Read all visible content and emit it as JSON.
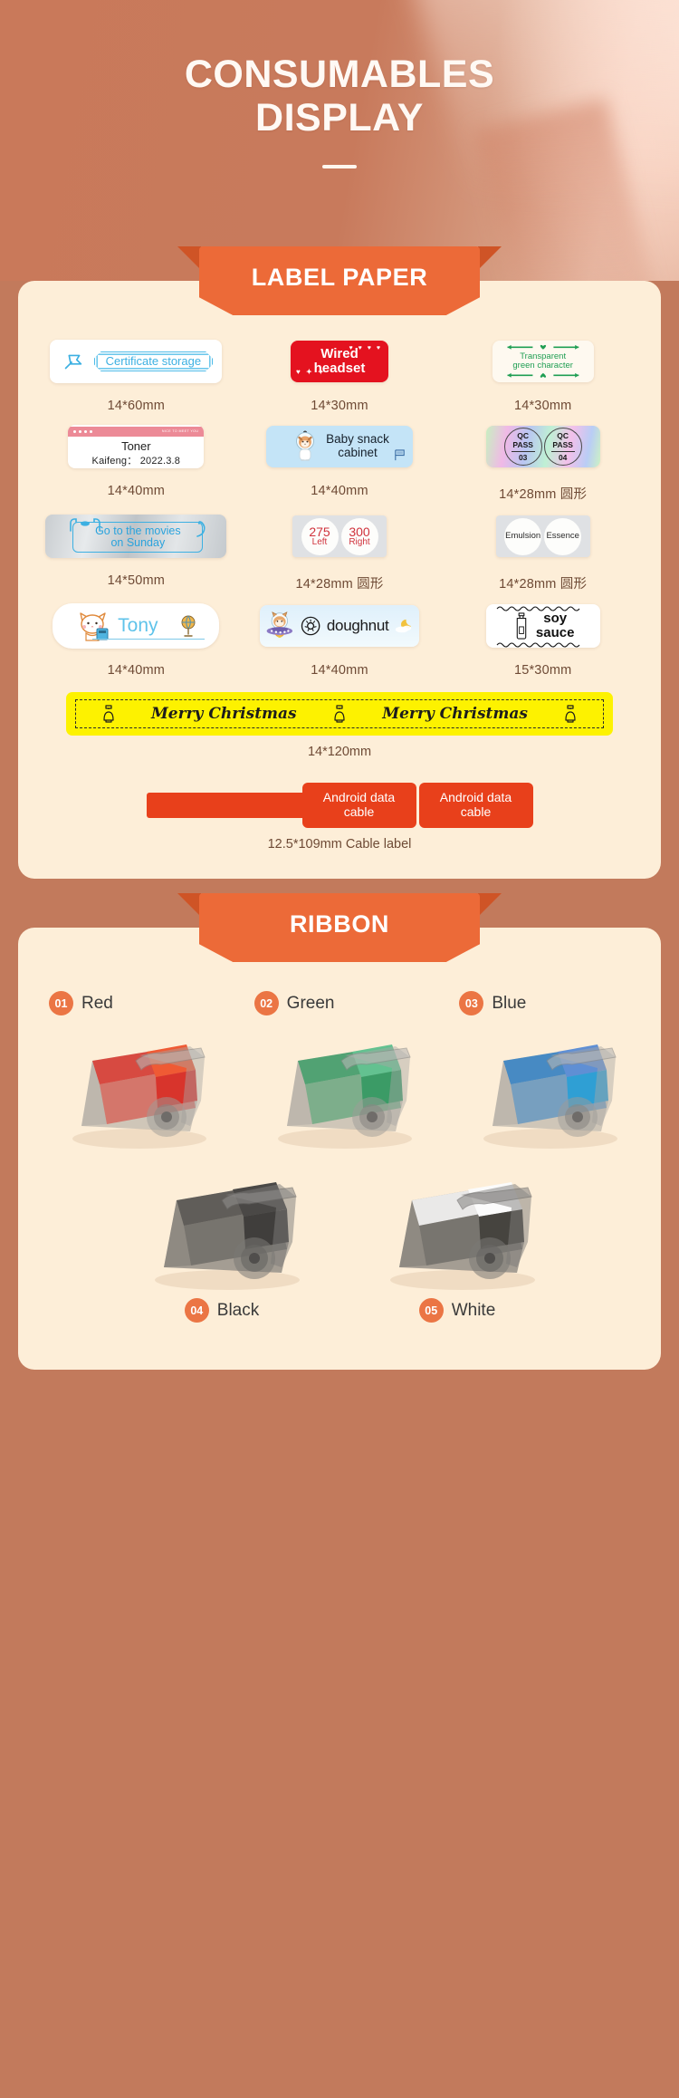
{
  "hero": {
    "title_line1": "CONSUMABLES",
    "title_line2": "DISPLAY",
    "bg_color": "#c87a5c",
    "title_color": "#fff9f4"
  },
  "sections": [
    {
      "banner_label": "LABEL PAPER",
      "banner_color": "#ec6a38"
    },
    {
      "banner_label": "RIBBON",
      "banner_color": "#ec6a38"
    }
  ],
  "label_paper": {
    "row1": [
      {
        "size": "14*60mm",
        "text": "Certificate storage",
        "icon": "pin-icon",
        "color": "#3cb0e2"
      },
      {
        "size": "14*30mm",
        "text_line1": "Wired",
        "text_line2": "headset",
        "color": "#e4121f"
      },
      {
        "size": "14*30mm",
        "text_line1": "Transparent",
        "text_line2": "green character",
        "color": "#1f9e53"
      }
    ],
    "row2": [
      {
        "size": "14*40mm",
        "title": "Toner",
        "subtitle": "Kaifeng： 2022.3.8",
        "header_tag": "NICE TO MEET YOU",
        "color": "#ec8a97"
      },
      {
        "size": "14*40mm",
        "text_line1": "Baby snack",
        "text_line2": "cabinet",
        "icon": "astronaut-dog-icon",
        "color": "#c4e4f7"
      },
      {
        "size": "14*28mm 圆形",
        "circles": [
          {
            "l1": "QC",
            "l2": "PASS",
            "num": "03"
          },
          {
            "l1": "QC",
            "l2": "PASS",
            "num": "04"
          }
        ]
      }
    ],
    "row3": [
      {
        "size": "14*50mm",
        "text_line1": "Go to the movies",
        "text_line2": "on Sunday",
        "color": "#2aa3dd"
      },
      {
        "size": "14*28mm 圆形",
        "circles": [
          {
            "big": "275",
            "sml": "Left"
          },
          {
            "big": "300",
            "sml": "Right"
          }
        ]
      },
      {
        "size": "14*28mm 圆形",
        "circles": [
          {
            "word": "Emulsion"
          },
          {
            "word": "Essence"
          }
        ]
      }
    ],
    "row4": [
      {
        "size": "14*40mm",
        "name": "Tony",
        "icon": "cat-icon"
      },
      {
        "size": "14*40mm",
        "word": "doughnut",
        "icon": "astronaut-cat-icon"
      },
      {
        "size": "15*30mm",
        "text_line1": "soy",
        "text_line2": "sauce",
        "icon": "bottle-icon"
      }
    ],
    "christmas": {
      "size": "14*120mm",
      "text": "Merry Christmas",
      "repeats": 2,
      "bg_color": "#fdf200",
      "bell_icon": "bell-icon"
    },
    "cable": {
      "size_note": "12.5*109mm  Cable label",
      "block_line1": "Android data",
      "block_line2": "cable",
      "color": "#e8401b"
    }
  },
  "ribbon": {
    "items": [
      {
        "num": "01",
        "name": "Red",
        "color": "#d8342c"
      },
      {
        "num": "02",
        "name": "Green",
        "color": "#3b9b66"
      },
      {
        "num": "03",
        "name": "Blue",
        "color": "#2f7fc4"
      },
      {
        "num": "04",
        "name": "Black",
        "color": "#4a4a4a"
      },
      {
        "num": "05",
        "name": "White",
        "color": "#f2f2f2"
      }
    ],
    "badge_color": "#eb7544"
  }
}
